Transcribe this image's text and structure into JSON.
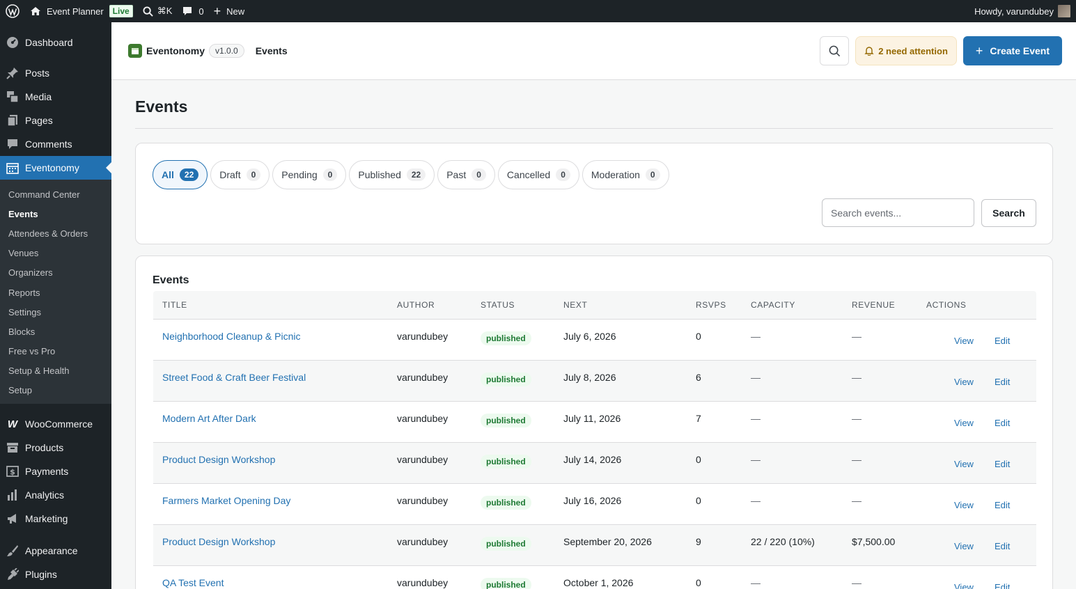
{
  "adminbar": {
    "site_name": "Event Planner",
    "live_badge": "Live",
    "shortcut": "⌘K",
    "comments_count": "0",
    "new_label": "New",
    "howdy": "Howdy, varundubey"
  },
  "sidebar": {
    "items": [
      {
        "label": "Dashboard",
        "icon": "dashboard-icon"
      },
      {
        "label": "Posts",
        "icon": "pin-icon"
      },
      {
        "label": "Media",
        "icon": "media-icon"
      },
      {
        "label": "Pages",
        "icon": "pages-icon"
      },
      {
        "label": "Comments",
        "icon": "comment-icon"
      },
      {
        "label": "Eventonomy",
        "icon": "calendar-icon"
      },
      {
        "label": "WooCommerce",
        "icon": "woo-icon"
      },
      {
        "label": "Products",
        "icon": "archive-icon"
      },
      {
        "label": "Payments",
        "icon": "dollar-icon"
      },
      {
        "label": "Analytics",
        "icon": "chart-icon"
      },
      {
        "label": "Marketing",
        "icon": "megaphone-icon"
      },
      {
        "label": "Appearance",
        "icon": "brush-icon"
      },
      {
        "label": "Plugins",
        "icon": "plugin-icon"
      }
    ],
    "submenu": [
      "Command Center",
      "Events",
      "Attendees & Orders",
      "Venues",
      "Organizers",
      "Reports",
      "Settings",
      "Blocks",
      "Free vs Pro",
      "Setup & Health",
      "Setup"
    ]
  },
  "header": {
    "brand": "Eventonomy",
    "version": "v1.0.0",
    "page": "Events",
    "attention": "2 need attention",
    "create": "Create Event"
  },
  "main": {
    "title": "Events",
    "filters": [
      {
        "label": "All",
        "count": "22"
      },
      {
        "label": "Draft",
        "count": "0"
      },
      {
        "label": "Pending",
        "count": "0"
      },
      {
        "label": "Published",
        "count": "22"
      },
      {
        "label": "Past",
        "count": "0"
      },
      {
        "label": "Cancelled",
        "count": "0"
      },
      {
        "label": "Moderation",
        "count": "0"
      }
    ],
    "search_placeholder": "Search events...",
    "search_button": "Search"
  },
  "table": {
    "title": "Events",
    "columns": [
      "TITLE",
      "AUTHOR",
      "STATUS",
      "NEXT",
      "RSVPS",
      "CAPACITY",
      "REVENUE",
      "ACTIONS"
    ],
    "rows": [
      {
        "title": "Neighborhood Cleanup & Picnic",
        "author": "varundubey",
        "status": "published",
        "next": "July 6, 2026",
        "rsvps": "0",
        "capacity": "—",
        "revenue": "—"
      },
      {
        "title": "Street Food & Craft Beer Festival",
        "author": "varundubey",
        "status": "published",
        "next": "July 8, 2026",
        "rsvps": "6",
        "capacity": "—",
        "revenue": "—"
      },
      {
        "title": "Modern Art After Dark",
        "author": "varundubey",
        "status": "published",
        "next": "July 11, 2026",
        "rsvps": "7",
        "capacity": "—",
        "revenue": "—"
      },
      {
        "title": "Product Design Workshop",
        "author": "varundubey",
        "status": "published",
        "next": "July 14, 2026",
        "rsvps": "0",
        "capacity": "—",
        "revenue": "—"
      },
      {
        "title": "Farmers Market Opening Day",
        "author": "varundubey",
        "status": "published",
        "next": "July 16, 2026",
        "rsvps": "0",
        "capacity": "—",
        "revenue": "—"
      },
      {
        "title": "Product Design Workshop",
        "author": "varundubey",
        "status": "published",
        "next": "September 20, 2026",
        "rsvps": "9",
        "capacity": "22 / 220 (10%)",
        "revenue": "$7,500.00"
      },
      {
        "title": "QA Test Event",
        "author": "varundubey",
        "status": "published",
        "next": "October 1, 2026",
        "rsvps": "0",
        "capacity": "—",
        "revenue": "—"
      }
    ],
    "view_label": "View",
    "edit_label": "Edit"
  },
  "colors": {
    "accent": "#2271b1",
    "sidebar_bg": "#1d2327",
    "published": "#1e7a34",
    "attention": "#946800"
  }
}
